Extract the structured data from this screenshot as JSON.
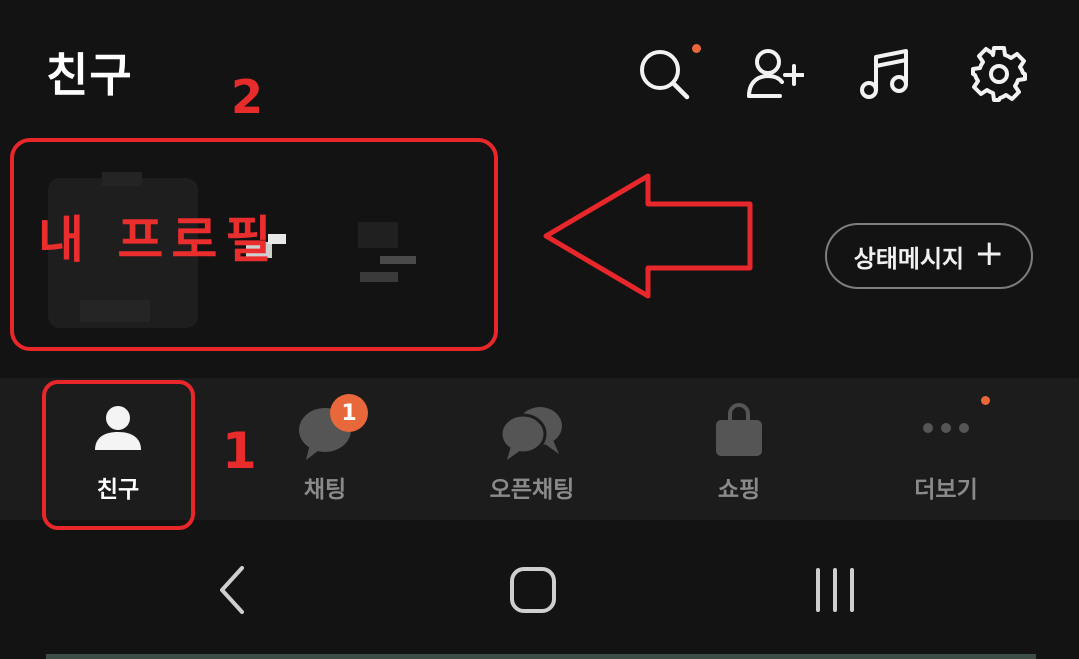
{
  "header": {
    "title": "친구",
    "icons": [
      "search-icon",
      "add-friend-icon",
      "music-icon",
      "settings-icon"
    ],
    "search_has_notification": true
  },
  "annotations": {
    "label_1": "1",
    "label_2": "2",
    "profile_overlay_text": "내 프로필",
    "color": "#e8272b"
  },
  "profile": {
    "status_button_label": "상태메시지",
    "status_button_icon": "plus-icon"
  },
  "tabs": [
    {
      "label": "친구",
      "icon": "person-icon",
      "active": true
    },
    {
      "label": "채팅",
      "icon": "chat-bubble-icon",
      "badge": "1"
    },
    {
      "label": "오픈채팅",
      "icon": "open-chat-icon"
    },
    {
      "label": "쇼핑",
      "icon": "shopping-bag-icon"
    },
    {
      "label": "더보기",
      "icon": "more-dots-icon",
      "has_notification": true
    }
  ],
  "system_nav": [
    "back-icon",
    "home-icon",
    "recents-icon"
  ],
  "colors": {
    "background": "#131313",
    "tab_bar": "#1c1c1c",
    "notification": "#e8673b",
    "active_label": "#ffffff",
    "inactive": "#8a8a8a"
  }
}
